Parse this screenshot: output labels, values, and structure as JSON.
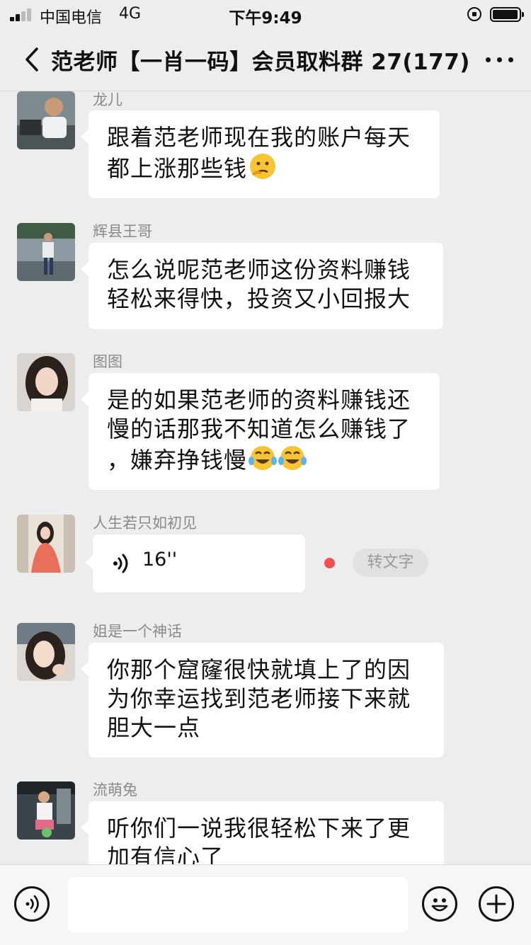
{
  "status_bar": {
    "carrier": "中国电信",
    "network": "4G",
    "time": "下午9:49",
    "signal_bars": 2,
    "battery_level": 0.9
  },
  "header": {
    "title": "范老师【一肖一码】会员取料群 27(177)",
    "back_icon": "chevron-left-icon",
    "more_icon": "more-dots-icon"
  },
  "messages": [
    {
      "sender": "龙儿",
      "lines": [
        "跟着范老师现在我的账户每天",
        "都上涨那些钱"
      ],
      "emojis": [
        "thinking-face-icon"
      ]
    },
    {
      "sender": "辉县王哥",
      "lines": [
        "怎么说呢范老师这份资料赚钱",
        "轻松来得快，投资又小回报大"
      ]
    },
    {
      "sender": "图图",
      "lines": [
        "是的如果范老师的资料赚钱还",
        "慢的话那我不知道怎么赚钱了",
        "，嫌弃挣钱慢"
      ],
      "emojis": [
        "tears-of-joy-icon",
        "tears-of-joy-icon"
      ]
    },
    {
      "sender": "人生若只如初见",
      "voice_duration": "16''",
      "transcribe_label": "转文字"
    },
    {
      "sender": "姐是一个神话",
      "lines": [
        "你那个窟窿很快就填上了的因",
        "为你幸运找到范老师接下来就",
        "胆大一点"
      ]
    },
    {
      "sender": "流萌兔",
      "lines": [
        "听你们一说我很轻松下来了更",
        "加有信心了"
      ]
    }
  ],
  "input_bar": {
    "voice_icon": "voice-input-icon",
    "emoji_icon": "emoji-icon",
    "plus_icon": "plus-icon",
    "text_value": ""
  },
  "colors": {
    "background": "#ededed",
    "bubble": "#ffffff",
    "name_text": "#8a8a8a",
    "unread_dot": "#f05050"
  }
}
